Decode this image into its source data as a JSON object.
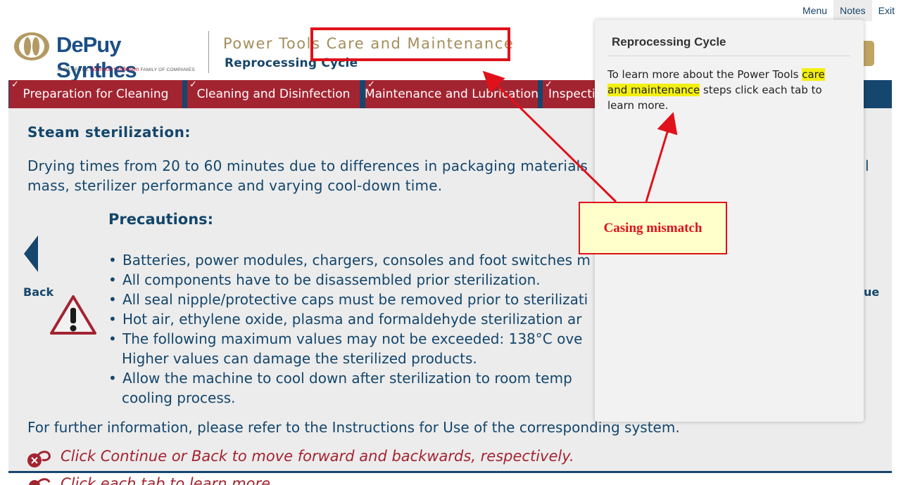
{
  "toplinks": {
    "menu": "Menu",
    "notes": "Notes",
    "exit": "Exit"
  },
  "header": {
    "logo_text": "DePuy Synthes",
    "logo_sub_prefix": "PART OF THE",
    "logo_sub_brand": "Johnson+Johnson",
    "logo_sub_suffix": "FAMILY OF COMPANIES",
    "course_title": "Power Tools Care and Maintenance",
    "course_subtitle": "Reprocessing Cycle"
  },
  "tabs": [
    {
      "label": "Preparation for Cleaning",
      "checked": true
    },
    {
      "label": "Cleaning and Disinfection",
      "checked": true
    },
    {
      "label": "Maintenance and Lubrication",
      "checked": true
    },
    {
      "label": "Inspection",
      "checked": true
    }
  ],
  "content": {
    "heading": "Steam sterilization:",
    "drying": "Drying times from 20 to 60 minutes due to differences in packaging materials",
    "drying_end": "l",
    "drying2": "mass, sterilizer performance and varying cool-down time.",
    "precautions_heading": "Precautions:",
    "bullets": [
      "Batteries, power modules, chargers, consoles and foot switches m",
      "All components have to be disassembled prior sterilization.",
      "All seal nipple/protective caps must be removed prior to sterilizati",
      "Hot air, ethylene oxide, plasma and formaldehyde sterilization ar",
      "The following maximum values may not be exceeded: 138°C ove",
      "Allow the machine to cool down after sterilization to room temp"
    ],
    "bullet5_cont": "Higher values can damage the sterilized products.",
    "bullet6_cont": "cooling process.",
    "further": "For further information, please refer to the Instructions for Use of the corresponding system.",
    "click_line": "Click Continue or Back to move forward and backwards, respectively.",
    "click_line2": "Click each tab to learn more."
  },
  "nav": {
    "back": "Back",
    "continue": "ue"
  },
  "notes_panel": {
    "title": "Reprocessing Cycle",
    "text_before": "To learn more about the Power Tools ",
    "text_highlight_1": "care",
    "text_highlight_2": "and maintenance",
    "text_after": " steps click each tab to learn more."
  },
  "annotation": {
    "label": "Casing mismatch"
  },
  "colors": {
    "navy": "#15466e",
    "tab_red": "#a32431",
    "gold": "#a38d5a",
    "annotation_red": "#e0111b",
    "highlight": "#f3ef12"
  }
}
